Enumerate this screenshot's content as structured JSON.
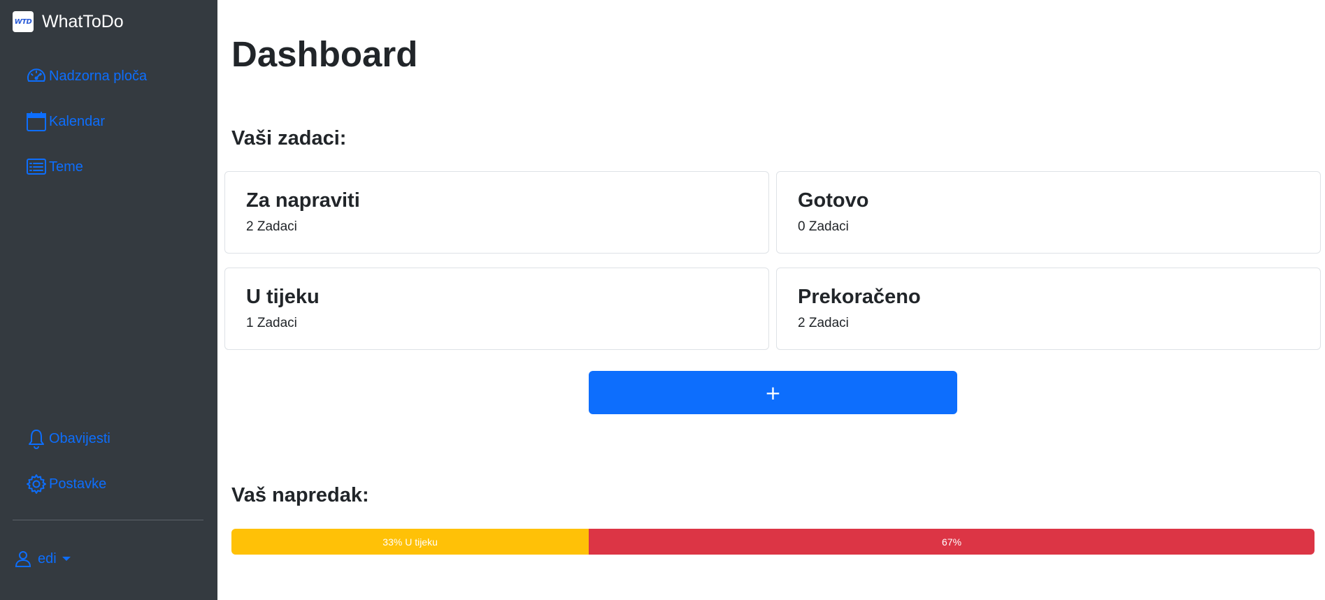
{
  "app": {
    "name": "WhatToDo",
    "logo_text": "WTD"
  },
  "sidebar": {
    "items": [
      {
        "label": "Nadzorna ploča",
        "icon": "speedometer-icon"
      },
      {
        "label": "Kalendar",
        "icon": "calendar-icon"
      },
      {
        "label": "Teme",
        "icon": "list-icon"
      }
    ],
    "bottom_items": [
      {
        "label": "Obavijesti",
        "icon": "bell-icon"
      },
      {
        "label": "Postavke",
        "icon": "gear-icon"
      }
    ],
    "user": {
      "name": "edi",
      "icon": "person-icon"
    }
  },
  "main": {
    "title": "Dashboard",
    "tasks_heading": "Vaši zadaci:",
    "cards": [
      {
        "title": "Za napraviti",
        "count": "2 Zadaci"
      },
      {
        "title": "Gotovo",
        "count": "0 Zadaci"
      },
      {
        "title": "U tijeku",
        "count": "1 Zadaci"
      },
      {
        "title": "Prekoračeno",
        "count": "2 Zadaci"
      }
    ],
    "add_button": "+",
    "progress_heading": "Vaš napredak:",
    "progress": [
      {
        "label": "33% U tijeku",
        "percent": 33,
        "color": "#ffc107"
      },
      {
        "label": "67%",
        "percent": 67,
        "color": "#dc3545"
      }
    ]
  },
  "colors": {
    "sidebar_bg": "#343a40",
    "accent": "#0d6efd"
  }
}
